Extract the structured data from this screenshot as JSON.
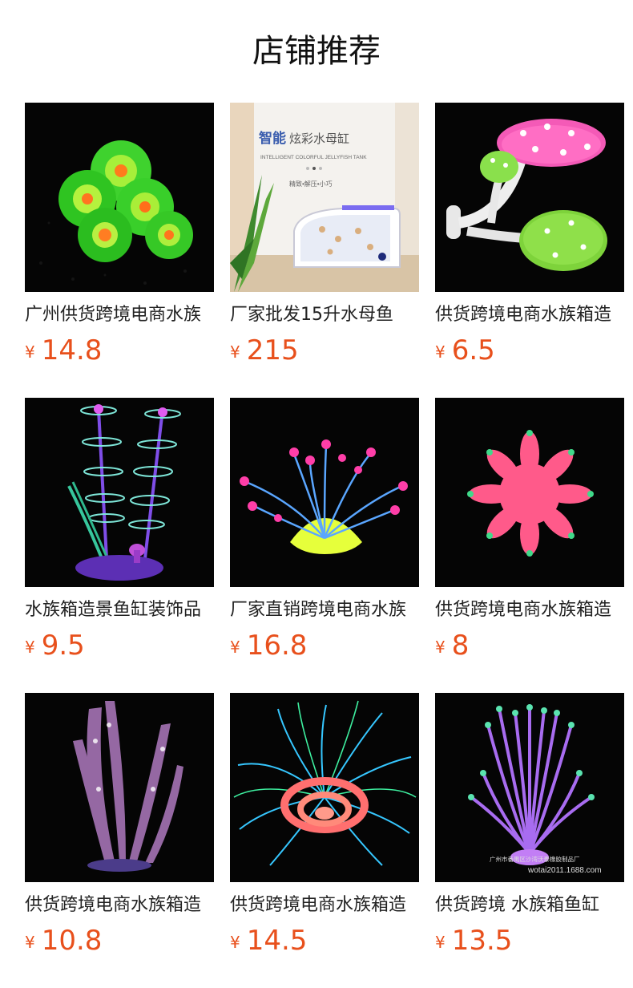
{
  "page": {
    "title": "店铺推荐"
  },
  "colors": {
    "price": "#e8501c"
  },
  "products": [
    {
      "name": "广州供货跨境电商水族",
      "currency": "¥",
      "price": "14.8",
      "image": "green-zoanthid-coral-image"
    },
    {
      "name": "厂家批发15升水母鱼",
      "currency": "¥",
      "price": "215",
      "image": "jellyfish-tank-image",
      "image_text": {
        "headline_bold": "智能",
        "headline": "炫彩水母缸",
        "subtitle": "INTELLIGENT COLORFUL JELLYFISH TANK",
        "tagline": "精致•解压•小巧"
      }
    },
    {
      "name": "供货跨境电商水族箱造",
      "currency": "¥",
      "price": "6.5",
      "image": "pink-mushroom-ornament-image"
    },
    {
      "name": "水族箱造景鱼缸装饰品",
      "currency": "¥",
      "price": "9.5",
      "image": "purple-stem-plant-image"
    },
    {
      "name": "厂家直销跨境电商水族",
      "currency": "¥",
      "price": "16.8",
      "image": "yellow-anemone-image"
    },
    {
      "name": "供货跨境电商水族箱造",
      "currency": "¥",
      "price": "8",
      "image": "pink-spiky-coral-image"
    },
    {
      "name": "供货跨境电商水族箱造",
      "currency": "¥",
      "price": "10.8",
      "image": "translucent-leaf-plant-image"
    },
    {
      "name": "供货跨境电商水族箱造",
      "currency": "¥",
      "price": "14.5",
      "image": "neon-tentacle-anemone-image"
    },
    {
      "name": "供货跨境 水族箱鱼缸",
      "currency": "¥",
      "price": "13.5",
      "image": "purple-tube-anemone-image",
      "image_text": {
        "watermark_line1": "广州市番禺区沙湾沃泰橡胶制品厂",
        "watermark_line2": "wotai2011.1688.com"
      }
    }
  ]
}
